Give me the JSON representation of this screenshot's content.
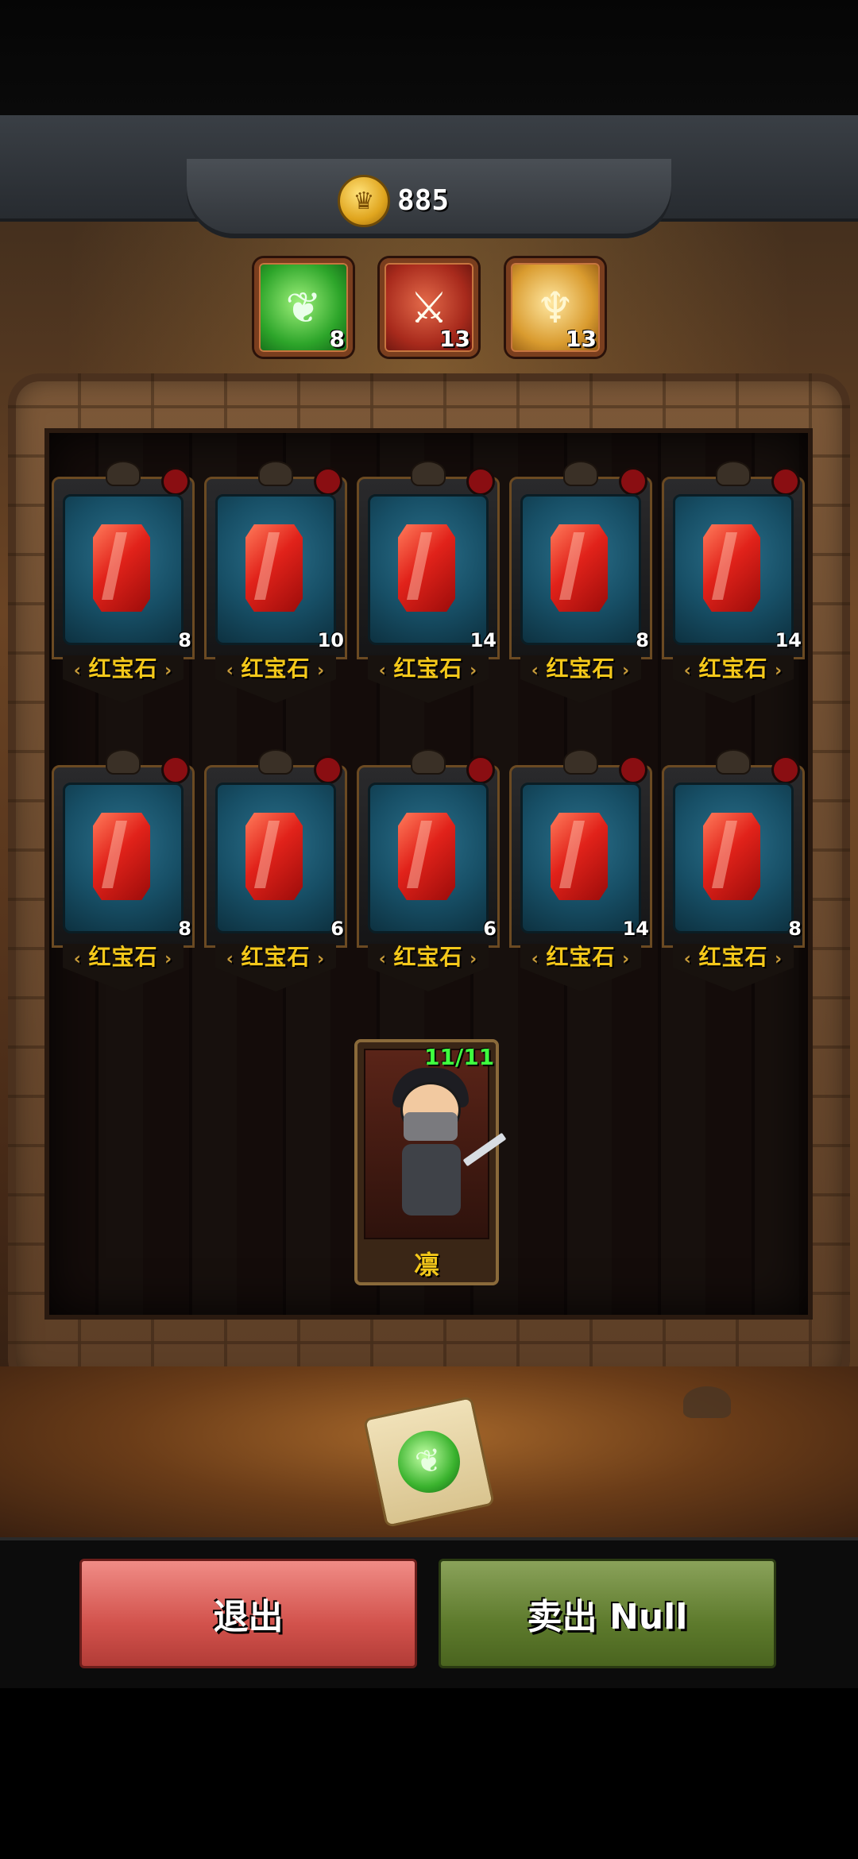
{
  "currency": {
    "icon": "crown-coin-icon",
    "amount": "885"
  },
  "resources": [
    {
      "icon": "leaf-orb-icon",
      "count": "8"
    },
    {
      "icon": "warrior-portrait-icon",
      "count": "13"
    },
    {
      "icon": "trident-emblem-icon",
      "count": "13"
    }
  ],
  "cards": [
    {
      "name": "红宝石",
      "count": "8"
    },
    {
      "name": "红宝石",
      "count": "10"
    },
    {
      "name": "红宝石",
      "count": "14"
    },
    {
      "name": "红宝石",
      "count": "8"
    },
    {
      "name": "红宝石",
      "count": "14"
    },
    {
      "name": "红宝石",
      "count": "8"
    },
    {
      "name": "红宝石",
      "count": "6"
    },
    {
      "name": "红宝石",
      "count": "6"
    },
    {
      "name": "红宝石",
      "count": "14"
    },
    {
      "name": "红宝石",
      "count": "8"
    }
  ],
  "hero": {
    "level": "11/11",
    "name": "凛"
  },
  "buttons": {
    "exit": "退出",
    "sell": "卖出 Null"
  },
  "colors": {
    "gem": "#e1221a",
    "card_label": "#f4c81a",
    "level_text": "#3fff3f",
    "exit_button": "#d2524c",
    "sell_button": "#5d7a2c"
  }
}
